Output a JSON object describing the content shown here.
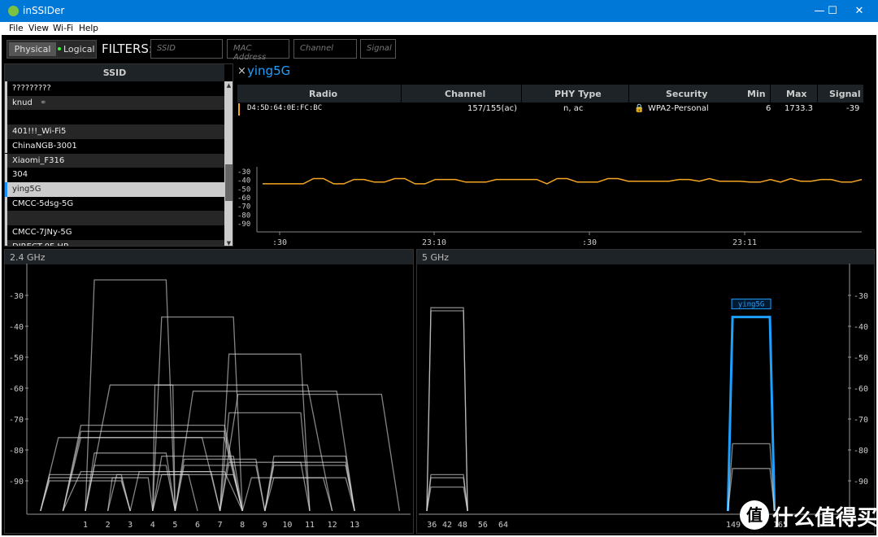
{
  "window": {
    "title": "inSSIDer",
    "controls": {
      "minimize": "—",
      "maximize": "☐",
      "close": "✕"
    }
  },
  "menu": [
    "File",
    "View",
    "Wi-Fi",
    "Help"
  ],
  "toolbar": {
    "physical": "Physical",
    "logical": "Logical",
    "filters_label": "FILTERS:",
    "filters": [
      {
        "placeholder": "SSID"
      },
      {
        "placeholder": "MAC Address"
      },
      {
        "placeholder": "Channel"
      },
      {
        "placeholder": "Signal"
      }
    ]
  },
  "ssid_list": {
    "header": "SSID",
    "rows": [
      {
        "name": "?????????"
      },
      {
        "name": "knud",
        "icon": "link-icon"
      },
      {
        "name": ""
      },
      {
        "name": "401!!!_Wi-Fi5"
      },
      {
        "name": "ChinaNGB-3001"
      },
      {
        "name": "Xiaomi_F316"
      },
      {
        "name": "304"
      },
      {
        "name": "ying5G",
        "selected": true
      },
      {
        "name": "CMCC-5dsg-5G"
      },
      {
        "name": ""
      },
      {
        "name": "CMCC-7JNy-5G"
      },
      {
        "name": "DIRECT-0F-HP"
      }
    ]
  },
  "detail": {
    "close": "×",
    "title": "ying5G",
    "columns": [
      "Radio",
      "Channel",
      "PHY Type",
      "Security",
      "Min",
      "Max",
      "Signal"
    ],
    "row": {
      "radio": "D4:5D:64:0E:FC:BC",
      "channel": "157/155(ac)",
      "phy": "n, ac",
      "security": "WPA2-Personal",
      "min": "6",
      "max": "1733.3",
      "signal": "-39",
      "color": "#f5a623"
    },
    "history": {
      "type": "line",
      "y_ticks": [
        -30,
        -40,
        -50,
        -60,
        -70,
        -80,
        -90
      ],
      "ylim": [
        -100,
        -25
      ],
      "x_ticks": [
        ":30",
        "23:10",
        ":30",
        "23:11"
      ],
      "values": [
        -44,
        -44,
        -44,
        -44,
        -44,
        -38,
        -38,
        -44,
        -44,
        -39,
        -39,
        -42,
        -42,
        -38,
        -38,
        -44,
        -44,
        -39,
        -39,
        -39,
        -42,
        -42,
        -42,
        -39,
        -39,
        -39,
        -39,
        -39,
        -44,
        -38,
        -38,
        -42,
        -42,
        -42,
        -38,
        -38,
        -41,
        -41,
        -41,
        -41,
        -41,
        -39,
        -39,
        -41,
        -38,
        -41,
        -41,
        -41,
        -42,
        -42,
        -39,
        -42,
        -38,
        -41,
        -41,
        -39,
        -39,
        -42,
        -42,
        -39
      ]
    }
  },
  "chart_data": [
    {
      "title": "2.4 GHz",
      "type": "area",
      "y_ticks": [
        -30,
        -40,
        -50,
        -60,
        -70,
        -80,
        -90
      ],
      "ylim": [
        -100,
        -25
      ],
      "x_ticks": [
        1,
        2,
        3,
        4,
        5,
        6,
        7,
        8,
        9,
        10,
        11,
        12,
        13
      ],
      "networks": [
        {
          "span": [
            1,
            5
          ],
          "signal": -25
        },
        {
          "span": [
            4,
            8
          ],
          "signal": -37
        },
        {
          "span": [
            7,
            11
          ],
          "signal": -49
        },
        {
          "span": [
            1,
            12
          ],
          "signal": -59
        },
        {
          "span": [
            4,
            5
          ],
          "signal": -59
        },
        {
          "span": [
            5,
            13
          ],
          "signal": -61
        },
        {
          "span": [
            7,
            15
          ],
          "signal": -62
        },
        {
          "span": [
            7,
            11
          ],
          "signal": -68
        },
        {
          "span": [
            0,
            8
          ],
          "signal": -72
        },
        {
          "span": [
            0,
            8
          ],
          "signal": -74
        },
        {
          "span": [
            -1,
            7
          ],
          "signal": -76
        },
        {
          "span": [
            0,
            8
          ],
          "signal": -76
        },
        {
          "span": [
            1,
            5
          ],
          "signal": -81
        },
        {
          "span": [
            4,
            8
          ],
          "signal": -82
        },
        {
          "span": [
            9,
            13
          ],
          "signal": -82
        },
        {
          "span": [
            5,
            9
          ],
          "signal": -83
        },
        {
          "span": [
            7,
            11
          ],
          "signal": -84
        },
        {
          "span": [
            9,
            13
          ],
          "signal": -84
        },
        {
          "span": [
            1,
            5
          ],
          "signal": -85
        },
        {
          "span": [
            5,
            9
          ],
          "signal": -85
        },
        {
          "span": [
            9,
            13
          ],
          "signal": -85
        },
        {
          "span": [
            0,
            8
          ],
          "signal": -87
        },
        {
          "span": [
            3,
            7
          ],
          "signal": -87
        },
        {
          "span": [
            -1,
            3
          ],
          "signal": -88
        },
        {
          "span": [
            2,
            6
          ],
          "signal": -88
        },
        {
          "span": [
            4,
            8
          ],
          "signal": -88
        },
        {
          "span": [
            -1,
            3
          ],
          "signal": -89
        },
        {
          "span": [
            2,
            4
          ],
          "signal": -89
        },
        {
          "span": [
            8,
            12
          ],
          "signal": -89
        },
        {
          "span": [
            9,
            13
          ],
          "signal": -89
        },
        {
          "span": [
            -1,
            3
          ],
          "signal": -90
        }
      ]
    },
    {
      "title": "5 GHz",
      "type": "area",
      "y_ticks": [
        -30,
        -40,
        -50,
        -60,
        -70,
        -80,
        -90
      ],
      "ylim": [
        -100,
        -25
      ],
      "x_ticks": [
        36,
        42,
        48,
        56,
        64,
        149,
        157,
        165
      ],
      "networks": [
        {
          "span": [
            34,
            50
          ],
          "signal": -34
        },
        {
          "span": [
            34,
            50
          ],
          "signal": -35
        },
        {
          "span": [
            34,
            50
          ],
          "signal": -88
        },
        {
          "span": [
            34,
            50
          ],
          "signal": -89
        },
        {
          "span": [
            34,
            50
          ],
          "signal": -92
        },
        {
          "span": [
            147,
            163
          ],
          "signal": -37,
          "label": "ying5G",
          "color": "#1ea0ff"
        },
        {
          "span": [
            147,
            163
          ],
          "signal": -78
        },
        {
          "span": [
            147,
            163
          ],
          "signal": -86
        }
      ]
    }
  ],
  "watermark": "什么值得买"
}
